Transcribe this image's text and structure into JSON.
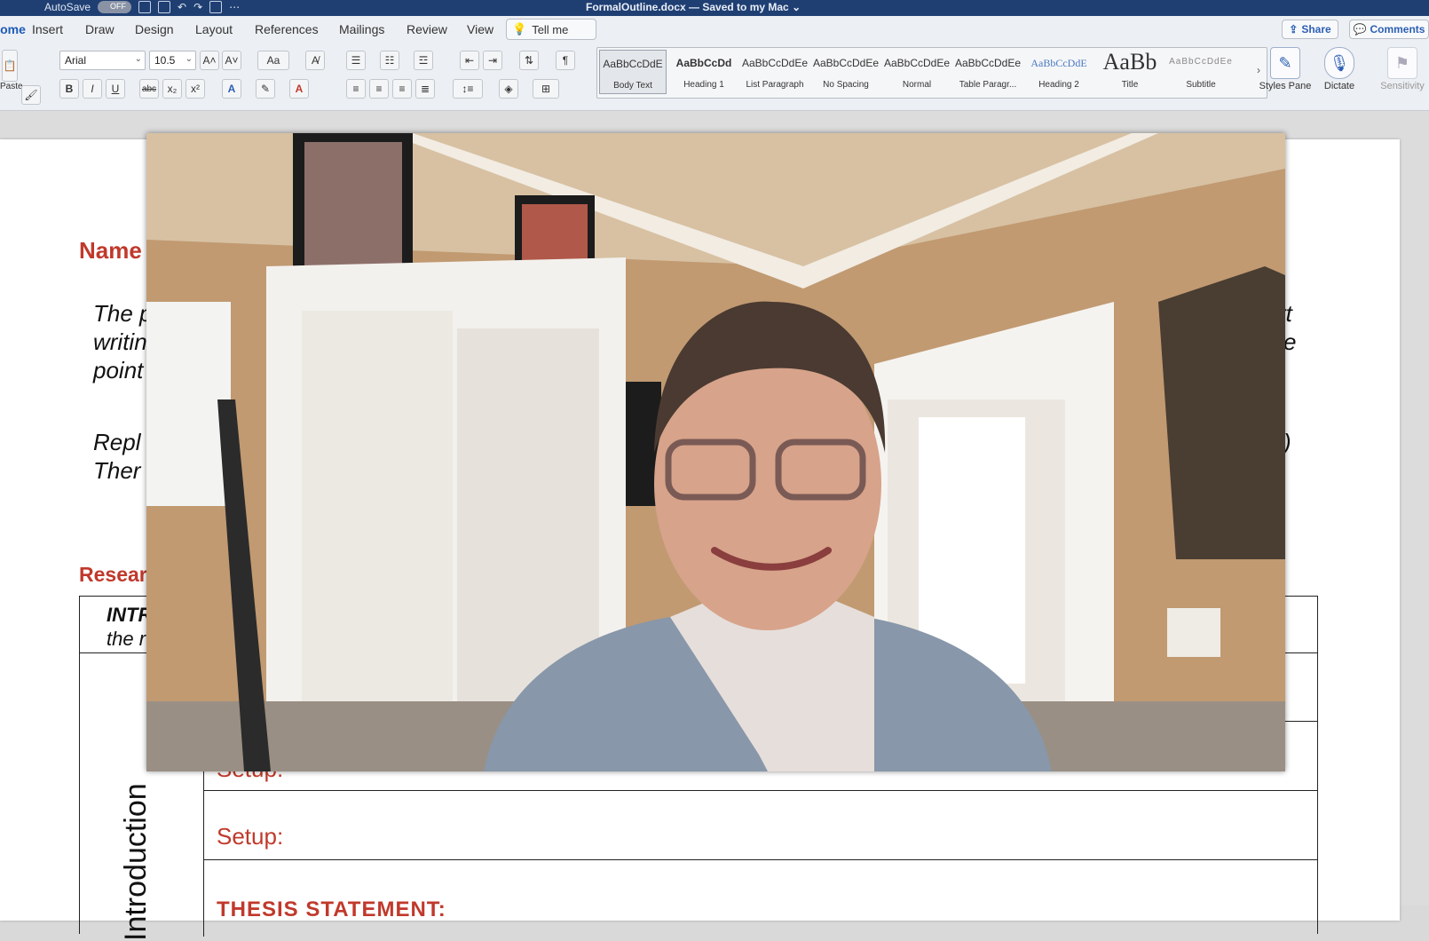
{
  "titlebar": {
    "autosave_label": "AutoSave",
    "autosave_state": "OFF",
    "document_title": "FormalOutline.docx — Saved to my Mac"
  },
  "tabs": [
    "Home",
    "Insert",
    "Draw",
    "Design",
    "Layout",
    "References",
    "Mailings",
    "Review",
    "View"
  ],
  "tell_me": "Tell me",
  "share_label": "Share",
  "comments_label": "Comments",
  "ribbon": {
    "paste_label": "Paste",
    "font_name": "Arial",
    "font_size": "10.5",
    "grow_font": "A˄",
    "shrink_font": "A˅",
    "change_case": "Aa",
    "bold": "B",
    "italic": "I",
    "underline": "U",
    "strikethrough": "abc",
    "subscript": "x₂",
    "superscript": "x²",
    "pilcrow": "¶",
    "styles": [
      {
        "sample": "AaBbCcDdE",
        "name": "Body Text",
        "selected": true
      },
      {
        "sample": "AaBbCcDd",
        "name": "Heading 1"
      },
      {
        "sample": "AaBbCcDdEe",
        "name": "List Paragraph"
      },
      {
        "sample": "AaBbCcDdEe",
        "name": "No Spacing"
      },
      {
        "sample": "AaBbCcDdEe",
        "name": "Normal"
      },
      {
        "sample": "AaBbCcDdEe",
        "name": "Table Paragr..."
      },
      {
        "sample": "AaBbCcDdE",
        "name": "Heading 2"
      },
      {
        "sample": "AaBb",
        "name": "Title"
      },
      {
        "sample": "AaBbCcDdEe",
        "name": "Subtitle"
      }
    ],
    "styles_pane_label": "Styles Pane",
    "dictate_label": "Dictate",
    "sensitivity_label": "Sensitivity"
  },
  "document": {
    "name_label": "Name",
    "para1_line1": "The p",
    "para1_line2": "writin",
    "para1_line3": "point",
    "para1_right1": "rt",
    "para1_right2": "e",
    "para2_line1": "Repl",
    "para2_line2": "Ther",
    "para2_right1": ")",
    "research_label": "Resear",
    "intro_row_bold": "INTR",
    "intro_row_line2": "the r",
    "side_label": "Introduction",
    "setup_1": "Setup:",
    "setup_2": "Setup:",
    "thesis_label": "THESIS STATEMENT:"
  }
}
